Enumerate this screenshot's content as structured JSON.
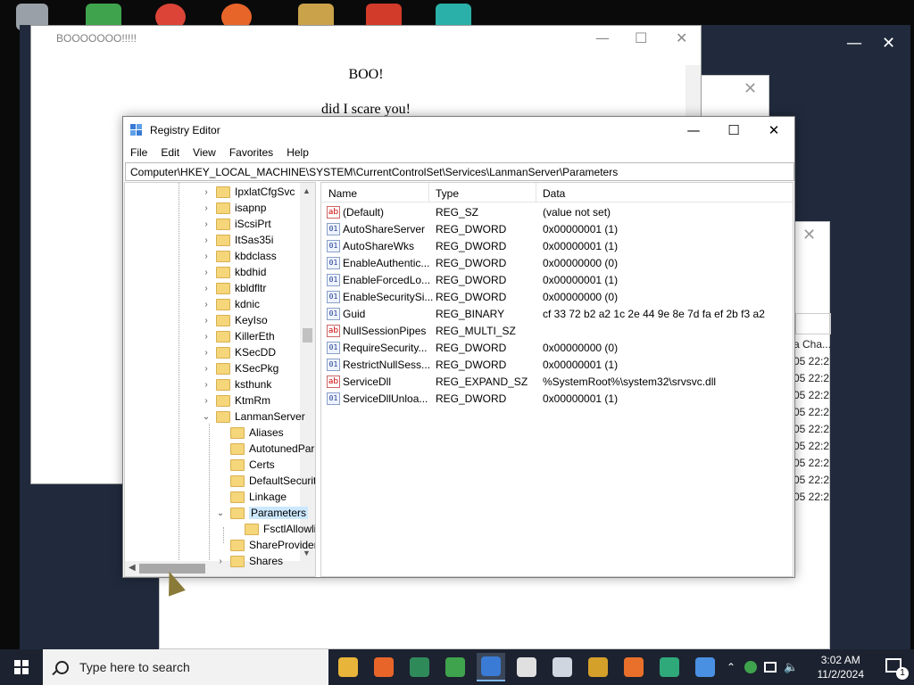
{
  "desktop": {
    "dark_window_controls": {
      "minimize": "—",
      "close": "✕"
    }
  },
  "behind_window": {
    "close": "✕",
    "cells": [
      "a Cha...",
      "05 22:2",
      "05 22:2",
      "05 22:2",
      "05 22:2",
      "05 22:2",
      "05 22:2",
      "05 22:2",
      "05 22:2",
      "05 22:2"
    ]
  },
  "boo_window": {
    "title": "BOOOOOOO!!!!!",
    "line1": "BOO!",
    "line2": "did I scare you!",
    "minimize": "—",
    "maximize": "☐",
    "close": "✕"
  },
  "regedit": {
    "title": "Registry Editor",
    "minimize": "—",
    "maximize": "☐",
    "close": "✕",
    "menu": [
      "File",
      "Edit",
      "View",
      "Favorites",
      "Help"
    ],
    "address": "Computer\\HKEY_LOCAL_MACHINE\\SYSTEM\\CurrentControlSet\\Services\\LanmanServer\\Parameters",
    "tree": [
      {
        "label": "IpxlatCfgSvc",
        "level": 0,
        "arrow": "›"
      },
      {
        "label": "isapnp",
        "level": 0,
        "arrow": "›"
      },
      {
        "label": "iScsiPrt",
        "level": 0,
        "arrow": "›"
      },
      {
        "label": "ItSas35i",
        "level": 0,
        "arrow": "›"
      },
      {
        "label": "kbdclass",
        "level": 0,
        "arrow": "›"
      },
      {
        "label": "kbdhid",
        "level": 0,
        "arrow": "›"
      },
      {
        "label": "kbldfltr",
        "level": 0,
        "arrow": "›"
      },
      {
        "label": "kdnic",
        "level": 0,
        "arrow": "›"
      },
      {
        "label": "KeyIso",
        "level": 0,
        "arrow": "›"
      },
      {
        "label": "KillerEth",
        "level": 0,
        "arrow": "›"
      },
      {
        "label": "KSecDD",
        "level": 0,
        "arrow": "›"
      },
      {
        "label": "KSecPkg",
        "level": 0,
        "arrow": "›"
      },
      {
        "label": "ksthunk",
        "level": 0,
        "arrow": "›"
      },
      {
        "label": "KtmRm",
        "level": 0,
        "arrow": "›"
      },
      {
        "label": "LanmanServer",
        "level": 0,
        "arrow": "⌄"
      },
      {
        "label": "Aliases",
        "level": 1,
        "arrow": ""
      },
      {
        "label": "AutotunedParameters",
        "level": 1,
        "arrow": ""
      },
      {
        "label": "Certs",
        "level": 1,
        "arrow": ""
      },
      {
        "label": "DefaultSecurity",
        "level": 1,
        "arrow": ""
      },
      {
        "label": "Linkage",
        "level": 1,
        "arrow": ""
      },
      {
        "label": "Parameters",
        "level": 1,
        "arrow": "⌄",
        "selected": true
      },
      {
        "label": "FsctlAllowlist",
        "level": 2,
        "arrow": ""
      },
      {
        "label": "ShareProviders",
        "level": 1,
        "arrow": ""
      },
      {
        "label": "Shares",
        "level": 1,
        "arrow": "›"
      }
    ],
    "columns": [
      "Name",
      "Type",
      "Data"
    ],
    "values": [
      {
        "icon": "ab",
        "name": "(Default)",
        "type": "REG_SZ",
        "data": "(value not set)"
      },
      {
        "icon": "bin",
        "name": "AutoShareServer",
        "type": "REG_DWORD",
        "data": "0x00000001 (1)"
      },
      {
        "icon": "bin",
        "name": "AutoShareWks",
        "type": "REG_DWORD",
        "data": "0x00000001 (1)"
      },
      {
        "icon": "bin",
        "name": "EnableAuthentic...",
        "type": "REG_DWORD",
        "data": "0x00000000 (0)"
      },
      {
        "icon": "bin",
        "name": "EnableForcedLo...",
        "type": "REG_DWORD",
        "data": "0x00000001 (1)"
      },
      {
        "icon": "bin",
        "name": "EnableSecuritySi...",
        "type": "REG_DWORD",
        "data": "0x00000000 (0)"
      },
      {
        "icon": "bin",
        "name": "Guid",
        "type": "REG_BINARY",
        "data": "cf 33 72 b2 a2 1c 2e 44 9e 8e 7d fa ef 2b f3 a2"
      },
      {
        "icon": "ab",
        "name": "NullSessionPipes",
        "type": "REG_MULTI_SZ",
        "data": ""
      },
      {
        "icon": "bin",
        "name": "RequireSecurity...",
        "type": "REG_DWORD",
        "data": "0x00000000 (0)"
      },
      {
        "icon": "bin",
        "name": "RestrictNullSess...",
        "type": "REG_DWORD",
        "data": "0x00000001 (1)"
      },
      {
        "icon": "ab",
        "name": "ServiceDll",
        "type": "REG_EXPAND_SZ",
        "data": "%SystemRoot%\\system32\\srvsvc.dll"
      },
      {
        "icon": "bin",
        "name": "ServiceDllUnloa...",
        "type": "REG_DWORD",
        "data": "0x00000001 (1)"
      }
    ]
  },
  "taskbar": {
    "search_placeholder": "Type here to search",
    "apps": [
      {
        "name": "file-explorer",
        "color": "#e8b43a"
      },
      {
        "name": "firefox",
        "color": "#e8652a"
      },
      {
        "name": "app-window",
        "color": "#2f8a5a"
      },
      {
        "name": "people",
        "color": "#3fa34d"
      },
      {
        "name": "regedit",
        "color": "#3a7bd5",
        "active": true
      },
      {
        "name": "7zip",
        "color": "#e0e0e0"
      },
      {
        "name": "notepad",
        "color": "#cfd6e0"
      },
      {
        "name": "vpn",
        "color": "#d4a02a"
      },
      {
        "name": "rss",
        "color": "#e8702a"
      },
      {
        "name": "app-green",
        "color": "#2fa87a"
      },
      {
        "name": "registry-blocks",
        "color": "#4a90e2"
      }
    ],
    "time": "3:02 AM",
    "date": "11/2/2024",
    "notification_count": "1"
  }
}
